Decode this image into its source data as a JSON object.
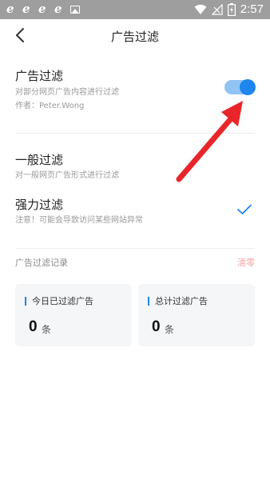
{
  "status_bar": {
    "time": "2:57",
    "notification_icons": [
      "browser-e-icon",
      "browser-e-icon",
      "browser-e-icon",
      "browser-e-icon",
      "image-icon"
    ],
    "system_icons": [
      "wifi-icon",
      "signal-icon",
      "battery-charging-icon"
    ]
  },
  "header": {
    "title": "广告过滤",
    "back_icon": "chevron-left-icon"
  },
  "ad_filter": {
    "title": "广告过滤",
    "subtitle": "对部分网页广告内容进行过滤",
    "author": "作者：Peter.Wong",
    "enabled": true
  },
  "modes": [
    {
      "title": "一般过滤",
      "subtitle": "对一般网页广告形式进行过滤",
      "selected": false
    },
    {
      "title": "强力过滤",
      "subtitle": "注意！可能会导致访问某些网站异常",
      "selected": true
    }
  ],
  "records": {
    "title": "广告过滤记录",
    "clear_label": "清零",
    "cards": [
      {
        "label": "今日已过滤广告",
        "value": "0",
        "unit": "条"
      },
      {
        "label": "总计过滤广告",
        "value": "0",
        "unit": "条"
      }
    ]
  },
  "colors": {
    "accent": "#1e86ec",
    "toggle_track": "#90c4f5",
    "clear_text": "#f7a4a4",
    "arrow": "#e8262a",
    "status_bar": "#9e9e9e"
  }
}
